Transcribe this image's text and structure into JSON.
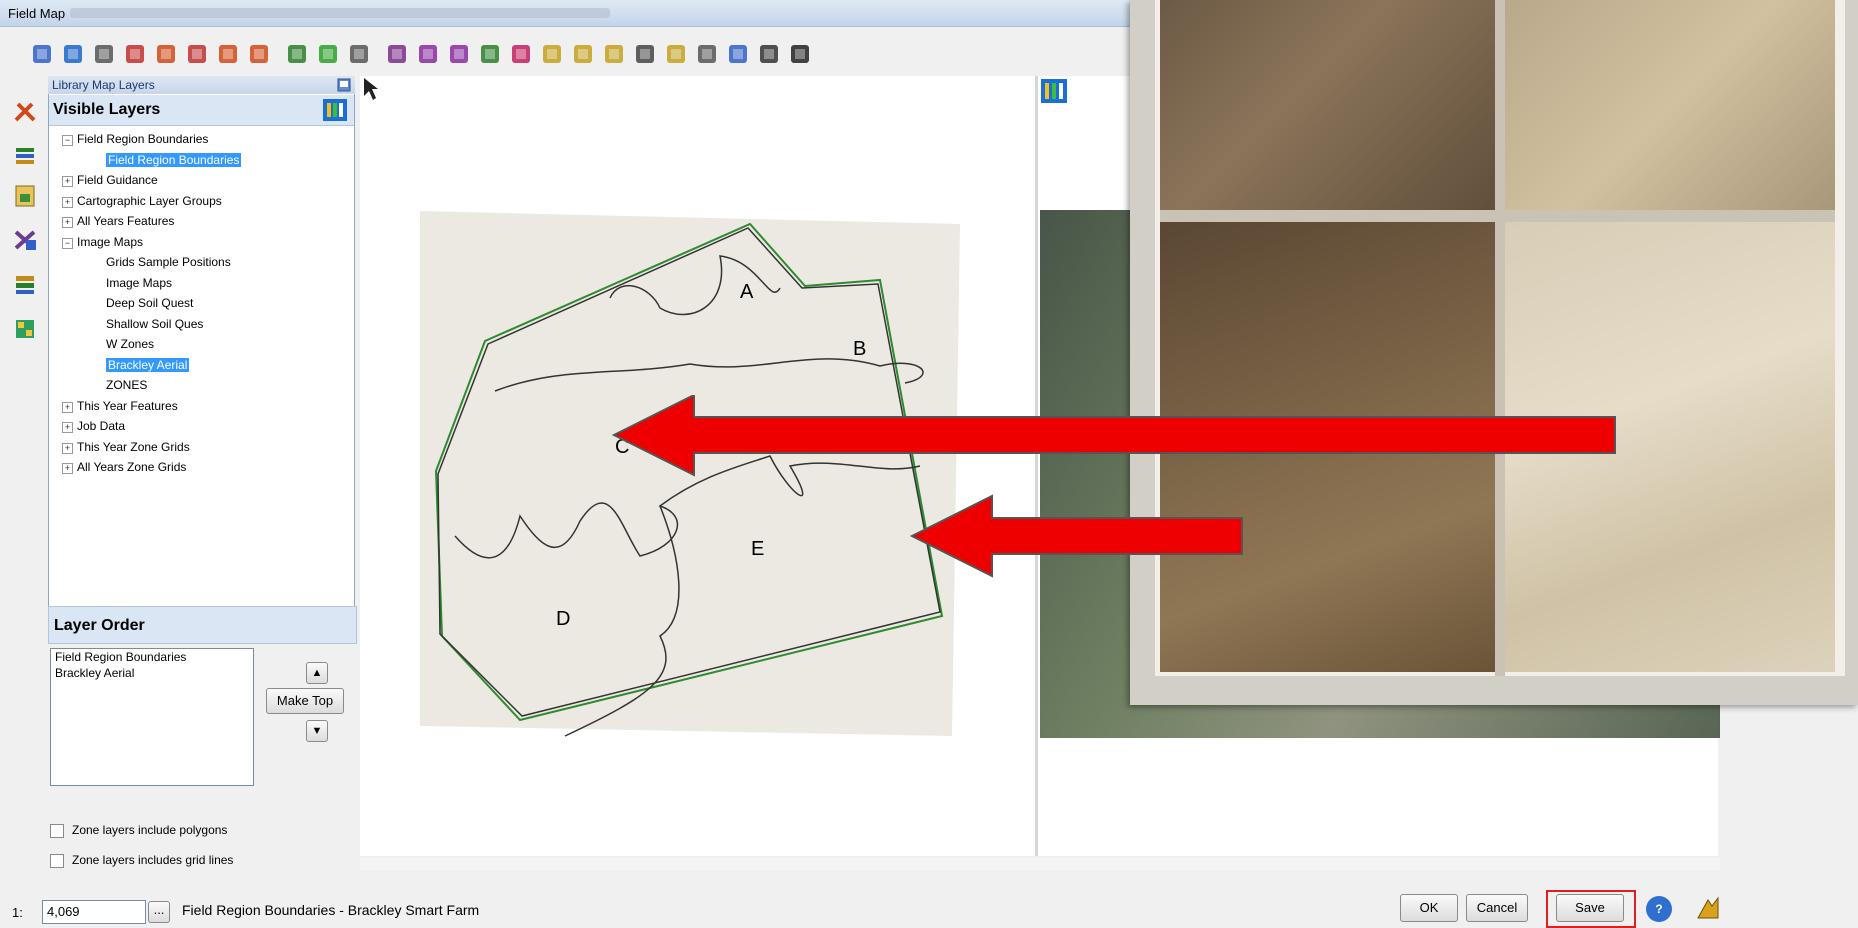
{
  "window": {
    "title": "Field Map"
  },
  "toolbar": {
    "icons": [
      "layout-icon",
      "save-icon",
      "print-icon",
      "table-icon",
      "undo-icon",
      "zoom-in-icon",
      "zoom-out-icon",
      "eraser-icon",
      "map-layer-icon",
      "fill-icon",
      "search-zoom-icon",
      "target-icon",
      "add-point-icon",
      "move-point-icon",
      "check-map-icon",
      "delete-point-icon",
      "line-tool-icon",
      "polygon-tool-icon",
      "user-tool-icon",
      "area-tool-icon",
      "wave-tool-icon",
      "grid-tool-icon",
      "zoom-extent-icon",
      "hand-tool-icon",
      "pointer-icon"
    ]
  },
  "sidebar_icons": [
    "tools-icon",
    "layers-icon",
    "document-icon",
    "scissors-icon",
    "stack-icon",
    "grid-icon"
  ],
  "library": {
    "header": "Library Map Layers",
    "visible_title": "Visible Layers",
    "tree": [
      {
        "label": "Field Region Boundaries",
        "level": 1,
        "toggle": "−"
      },
      {
        "label": "Field Region Boundaries",
        "level": 2,
        "selected": true
      },
      {
        "label": "Field Guidance",
        "level": 1,
        "toggle": "+"
      },
      {
        "label": "Cartographic Layer Groups",
        "level": 1,
        "toggle": "+"
      },
      {
        "label": "All Years Features",
        "level": 1,
        "toggle": "+"
      },
      {
        "label": "Image Maps",
        "level": 1,
        "toggle": "−"
      },
      {
        "label": "Grids Sample Positions",
        "level": 2
      },
      {
        "label": "Image Maps",
        "level": 2
      },
      {
        "label": "Deep Soil Quest",
        "level": 2
      },
      {
        "label": "Shallow Soil Ques",
        "level": 2
      },
      {
        "label": "W Zones",
        "level": 2
      },
      {
        "label": "Brackley Aerial",
        "level": 2,
        "selected": true
      },
      {
        "label": "ZONES",
        "level": 2
      },
      {
        "label": "This Year Features",
        "level": 1,
        "toggle": "+"
      },
      {
        "label": "Job Data",
        "level": 1,
        "toggle": "+"
      },
      {
        "label": "This Year Zone Grids",
        "level": 1,
        "toggle": "+"
      },
      {
        "label": "All Years Zone Grids",
        "level": 1,
        "toggle": "+"
      }
    ]
  },
  "layer_order": {
    "title": "Layer Order",
    "items": [
      "Field Region Boundaries",
      "Brackley Aerial"
    ],
    "make_top": "Make Top",
    "up": "▲",
    "down": "▼"
  },
  "options": {
    "zone_polygons": "Zone layers include polygons",
    "zone_grid_lines": "Zone layers includes grid lines"
  },
  "map": {
    "zones": [
      "A",
      "B",
      "C",
      "D",
      "E"
    ]
  },
  "status": {
    "scale_prefix": "1:",
    "scale_value": "4,069",
    "scale_button": "...",
    "text": "Field Region Boundaries - Brackley Smart Farm"
  },
  "buttons": {
    "ok": "OK",
    "cancel": "Cancel",
    "save": "Save",
    "help": "?"
  },
  "colors": {
    "arrow": "#ee0000",
    "boundary_green": "#2e8b2e",
    "selection": "#3399ff",
    "save_outline": "#e02020"
  }
}
